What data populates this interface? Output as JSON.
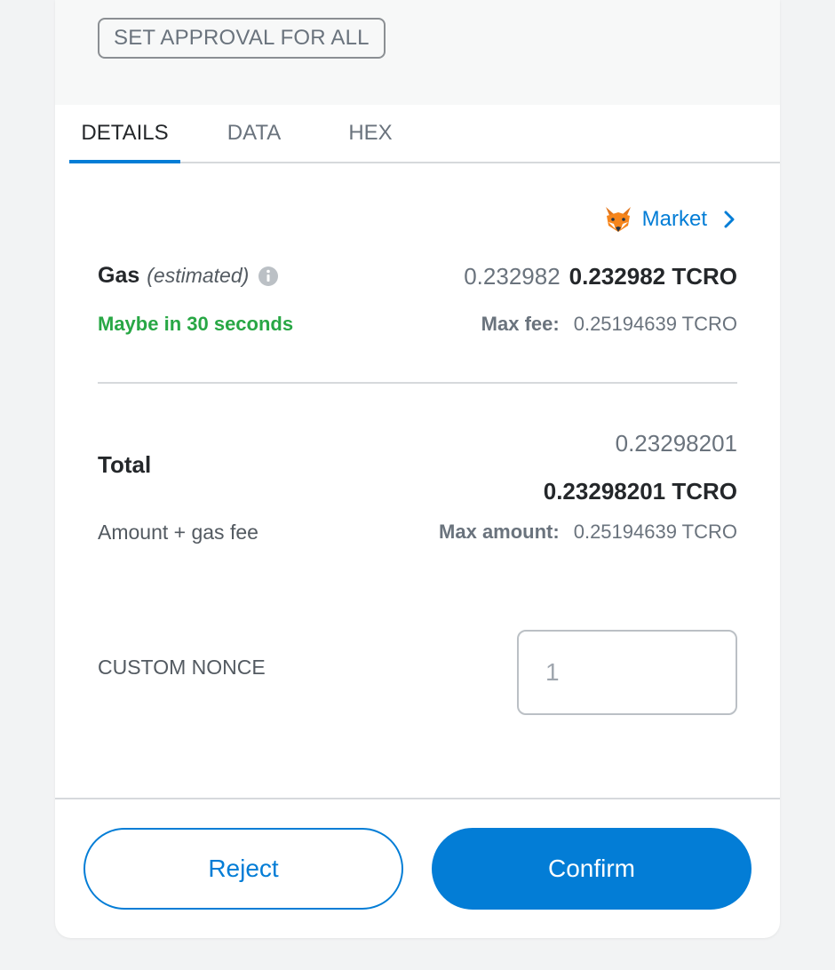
{
  "header": {
    "approval_badge": "SET APPROVAL FOR ALL"
  },
  "tabs": [
    {
      "label": "DETAILS",
      "active": true
    },
    {
      "label": "DATA",
      "active": false
    },
    {
      "label": "HEX",
      "active": false
    }
  ],
  "gas": {
    "market_label": "Market",
    "market_icon": "fox-icon",
    "title": "Gas",
    "estimated": "(estimated)",
    "info_icon": "info-icon",
    "value_light": "0.232982",
    "value_strong": "0.232982 TCRO",
    "timing": "Maybe in 30 seconds",
    "max_fee_label": "Max fee:",
    "max_fee_value": "0.25194639 TCRO"
  },
  "total": {
    "title": "Total",
    "value_light": "0.23298201",
    "value_strong": "0.23298201 TCRO",
    "subtitle": "Amount + gas fee",
    "max_amount_label": "Max amount:",
    "max_amount_value": "0.25194639 TCRO"
  },
  "nonce": {
    "label": "CUSTOM NONCE",
    "placeholder": "1",
    "value": ""
  },
  "footer": {
    "reject_label": "Reject",
    "confirm_label": "Confirm"
  },
  "colors": {
    "accent": "#037dd6",
    "success": "#28a745",
    "text_primary": "#24272a",
    "text_muted": "#6a737d"
  }
}
